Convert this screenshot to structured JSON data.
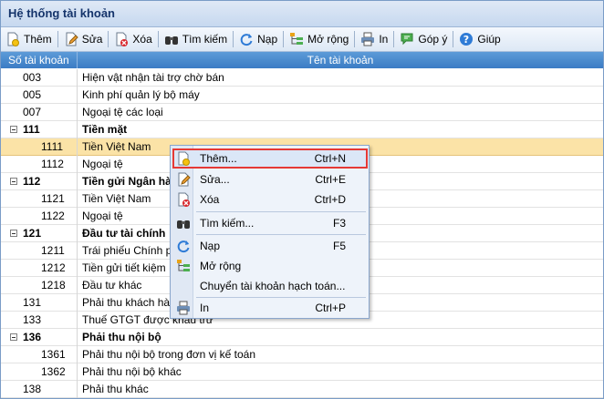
{
  "window": {
    "title": "Hệ thống tài khoản"
  },
  "toolbar": {
    "items": [
      {
        "label": "Thêm",
        "icon": "add-document-icon"
      },
      {
        "label": "Sửa",
        "icon": "edit-pencil-icon"
      },
      {
        "label": "Xóa",
        "icon": "delete-icon"
      },
      {
        "label": "Tìm kiếm",
        "icon": "binoculars-icon"
      },
      {
        "label": "Nạp",
        "icon": "refresh-icon"
      },
      {
        "label": "Mở rộng",
        "icon": "expand-tree-icon"
      },
      {
        "label": "In",
        "icon": "printer-icon"
      },
      {
        "label": "Góp ý",
        "icon": "feedback-icon"
      },
      {
        "label": "Giúp",
        "icon": "help-icon"
      }
    ]
  },
  "table": {
    "columns": [
      "Số tài khoản",
      "Tên tài khoản"
    ],
    "rows": [
      {
        "code": "003",
        "name": "Hiện vật nhận tài trợ chờ bán"
      },
      {
        "code": "005",
        "name": "Kinh phí quản lý bộ máy"
      },
      {
        "code": "007",
        "name": "Ngoại tệ các loại"
      },
      {
        "code": "111",
        "name": "Tiền mặt"
      },
      {
        "code": "1111",
        "name": "Tiền Việt Nam"
      },
      {
        "code": "1112",
        "name": "Ngoại tệ"
      },
      {
        "code": "112",
        "name": "Tiền gửi Ngân hàng"
      },
      {
        "code": "1121",
        "name": "Tiền Việt Nam"
      },
      {
        "code": "1122",
        "name": "Ngoại tệ"
      },
      {
        "code": "121",
        "name": "Đầu tư tài chính"
      },
      {
        "code": "1211",
        "name": "Trái phiếu Chính phủ"
      },
      {
        "code": "1212",
        "name": "Tiền gửi tiết kiệm"
      },
      {
        "code": "1218",
        "name": "Đầu tư khác"
      },
      {
        "code": "131",
        "name": "Phải thu khách hàng"
      },
      {
        "code": "133",
        "name": "Thuế GTGT được khấu trừ"
      },
      {
        "code": "136",
        "name": "Phải thu nội bộ"
      },
      {
        "code": "1361",
        "name": "Phải thu nội bộ trong đơn vị kế toán"
      },
      {
        "code": "1362",
        "name": "Phải thu nội bộ khác"
      },
      {
        "code": "138",
        "name": "Phải thu khác"
      }
    ]
  },
  "context_menu": {
    "items": [
      {
        "label": "Thêm...",
        "shortcut": "Ctrl+N",
        "icon": "add-document-icon"
      },
      {
        "label": "Sửa...",
        "shortcut": "Ctrl+E",
        "icon": "edit-pencil-icon"
      },
      {
        "label": "Xóa",
        "shortcut": "Ctrl+D",
        "icon": "delete-icon"
      },
      {
        "label": "Tìm kiếm...",
        "shortcut": "F3",
        "icon": "binoculars-icon"
      },
      {
        "label": "Nạp",
        "shortcut": "F5",
        "icon": "refresh-icon"
      },
      {
        "label": "Mở rộng",
        "shortcut": "",
        "icon": "expand-tree-icon"
      },
      {
        "label": "Chuyển tài khoản hạch toán...",
        "shortcut": "",
        "icon": ""
      },
      {
        "label": "In",
        "shortcut": "Ctrl+P",
        "icon": "printer-icon"
      }
    ]
  },
  "colors": {
    "header": "#3b7cc4",
    "selected_row": "#fbe3a7",
    "highlight_border": "#e53935"
  }
}
